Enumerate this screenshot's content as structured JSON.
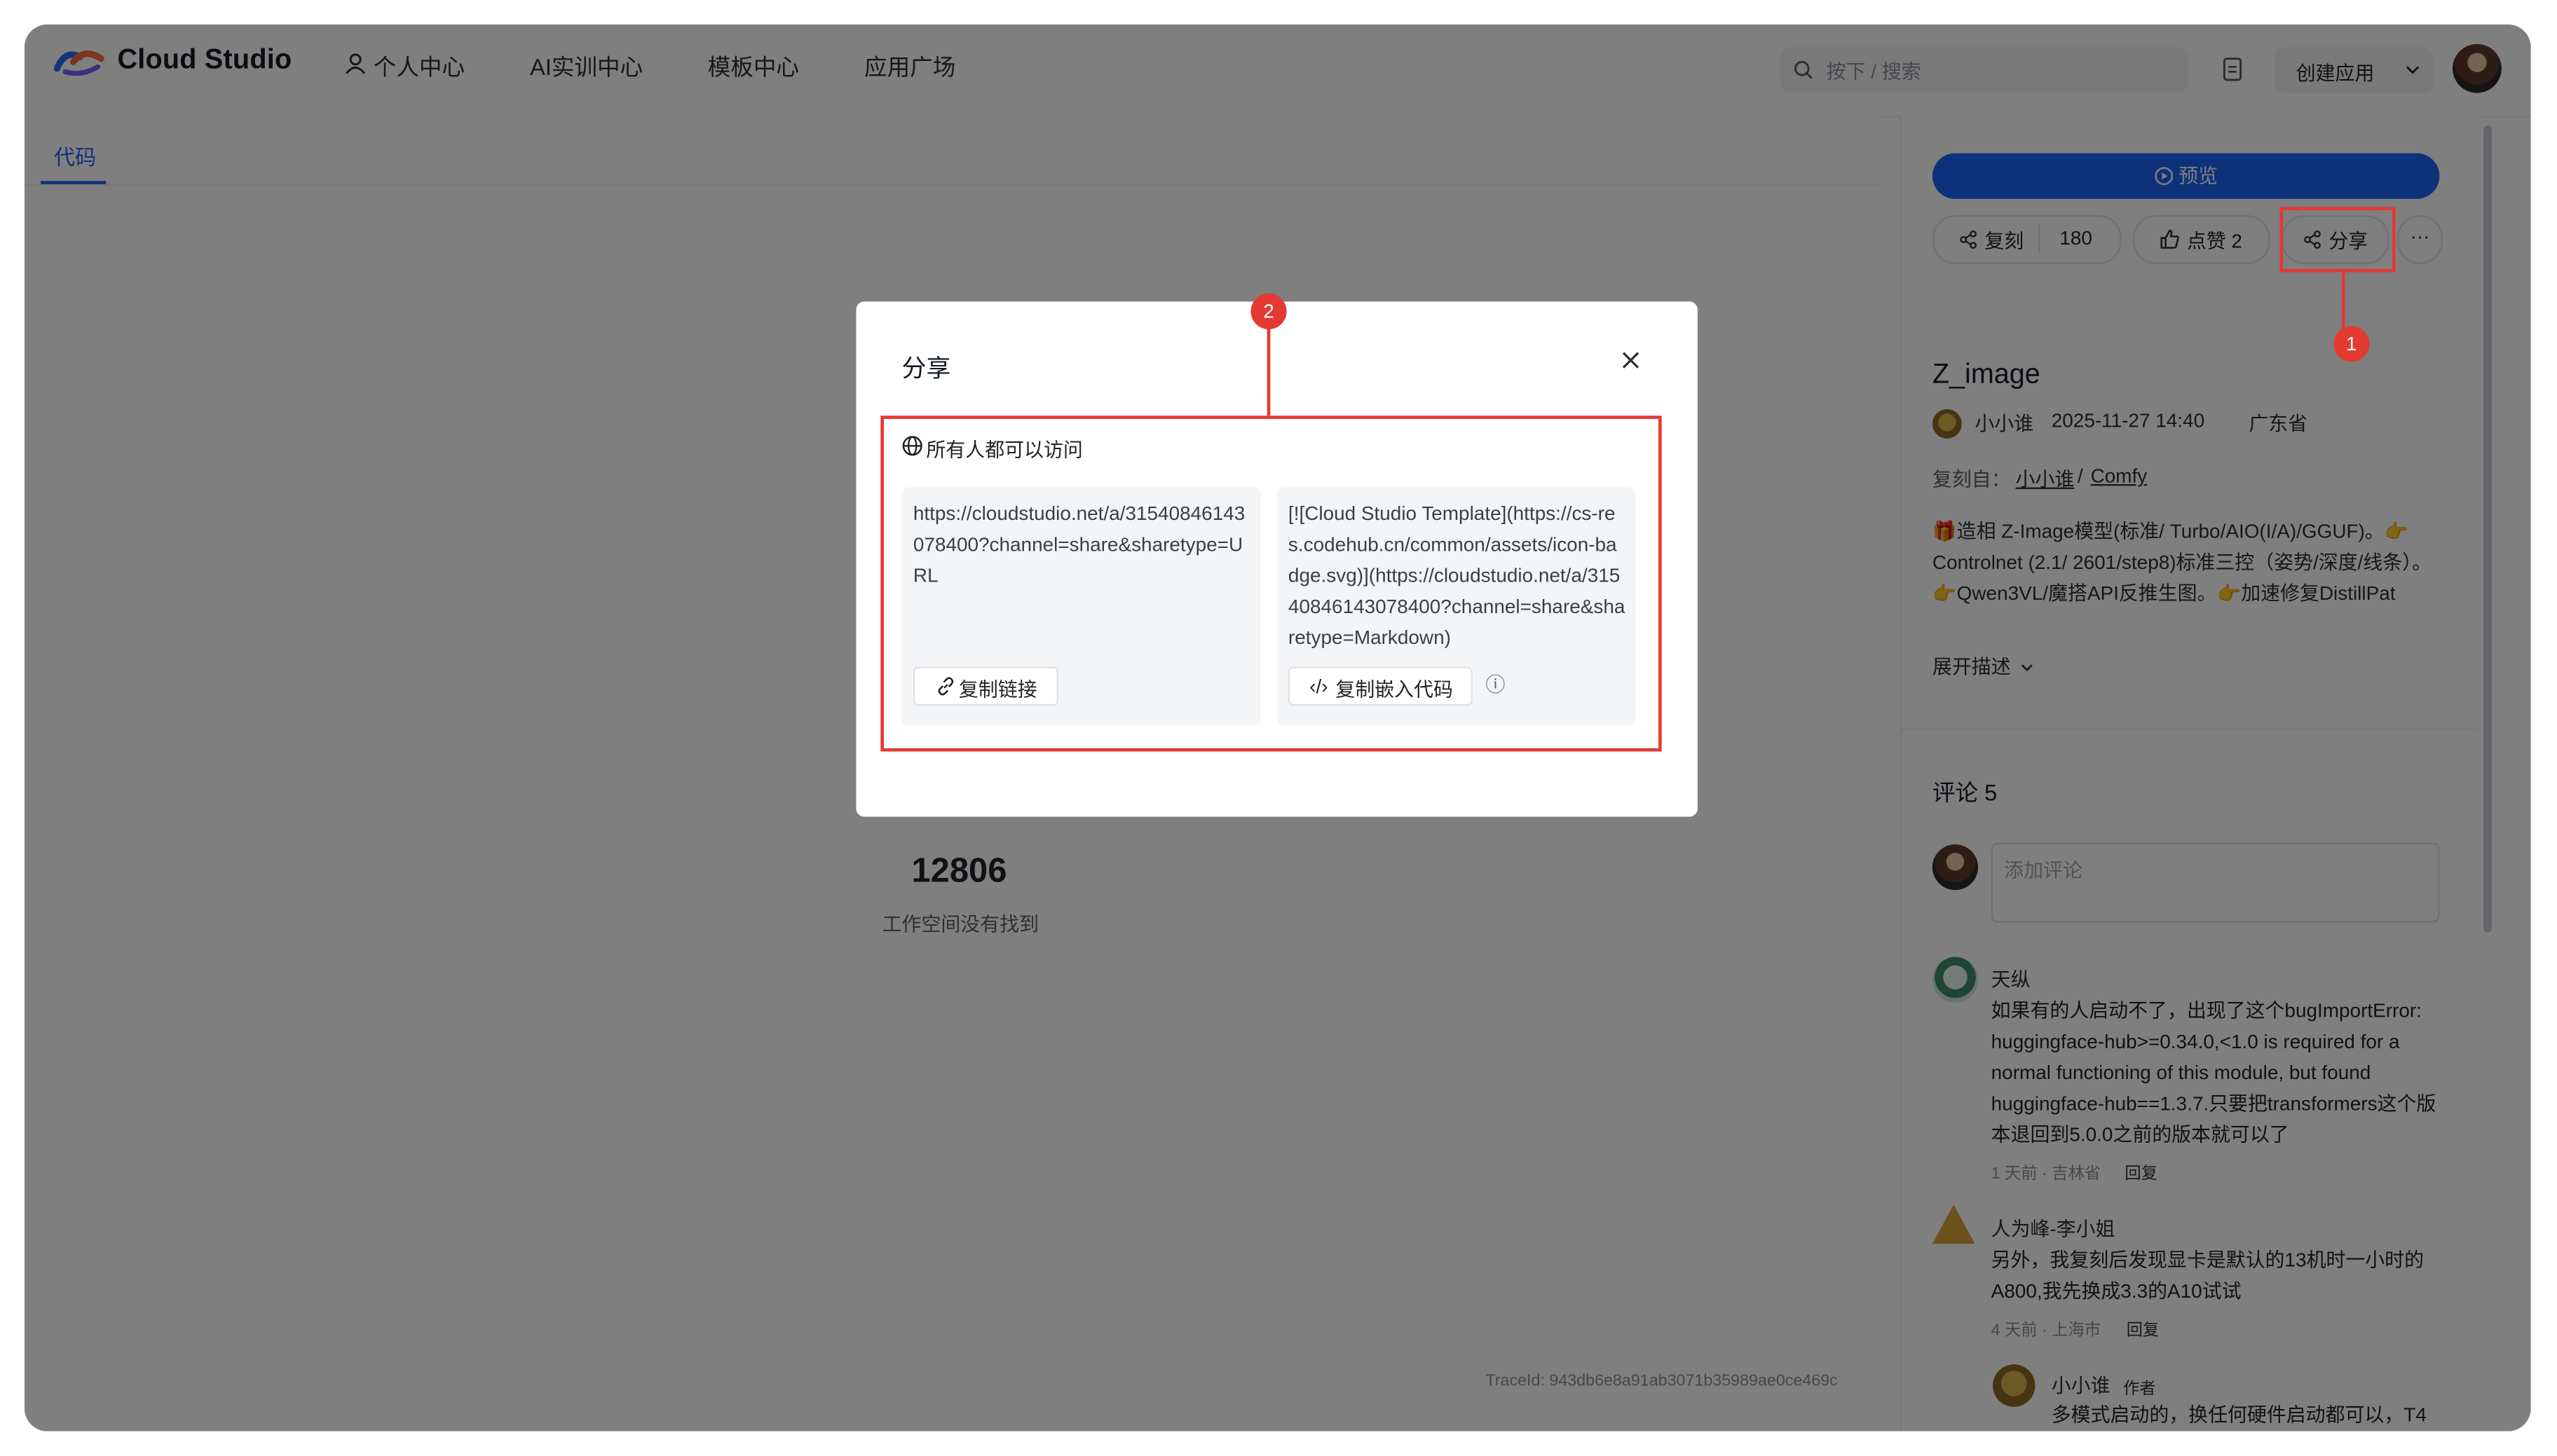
{
  "app": {
    "logo": "Cloud Studio",
    "nav": [
      "个人中心",
      "AI实训中心",
      "模板中心",
      "应用广场"
    ],
    "search_placeholder": "按下 /  搜索",
    "create_label": "创建应用"
  },
  "left": {
    "tab": "代码",
    "number": "12806",
    "not_found": "工作空间没有找到",
    "trace": "TraceId: 943db6e8a91ab3071b35989ae0ce469c"
  },
  "right": {
    "preview_label": "预览",
    "fork_label": "复刻",
    "fork_count": "180",
    "like_label": "点赞 2",
    "share_label": "分享",
    "more_label": "···",
    "title": "Z_image",
    "author": "小小谁",
    "date": "2025-11-27 14:40",
    "region": "广东省",
    "forked_from_label": "复刻自：",
    "forked_from_user": "小小谁",
    "forked_from_sep": "/",
    "forked_from_repo": "Comfy",
    "description": "🎁造相 Z-Image模型(标准/ Turbo/AIO(I/A)/GGUF)。👉Controlnet (2.1/ 2601/step8)标准三控（姿势/深度/线条）。👉Qwen3VL/魔搭API反推生图。👉加速修复DistillPat",
    "expand_label": "展开描述"
  },
  "comments": {
    "title": "评论 5",
    "placeholder": "添加评论",
    "items": [
      {
        "name": "天纵",
        "text": "如果有的人启动不了，出现了这个bugImportError: huggingface-hub>=0.34.0,<1.0 is required for a normal functioning of this module, but found huggingface-hub==1.3.7.只要把transformers这个版本退回到5.0.0之前的版本就可以了",
        "meta": "1 天前 · 吉林省",
        "reply": "回复"
      },
      {
        "name": "人为峰-李小姐",
        "text": "另外，我复刻后发现显卡是默认的13机时一小时的A800,我先换成3.3的A10试试",
        "meta": "4 天前 · 上海市",
        "reply": "回复"
      },
      {
        "name": "小小谁",
        "tag": "作者",
        "text": "多模式启动的，换任何硬件启动都可以，T4"
      }
    ]
  },
  "modal": {
    "title": "分享",
    "access": "所有人都可以访问",
    "link_text": "https://cloudstudio.net/a/31540846143078400?channel=share&sharetype=URL",
    "copy_link_label": "复制链接",
    "embed_text": "[![Cloud Studio Template](https://cs-res.codehub.cn/common/assets/icon-badge.svg)](https://cloudstudio.net/a/31540846143078400?channel=share&sharetype=Markdown)",
    "copy_embed_label": "复制嵌入代码",
    "info_label": "ⓘ"
  },
  "annotations": {
    "badge_1": "1",
    "badge_2": "2"
  },
  "colors": {
    "accent": "#1b64f2",
    "annotation_red": "#e33a32"
  }
}
